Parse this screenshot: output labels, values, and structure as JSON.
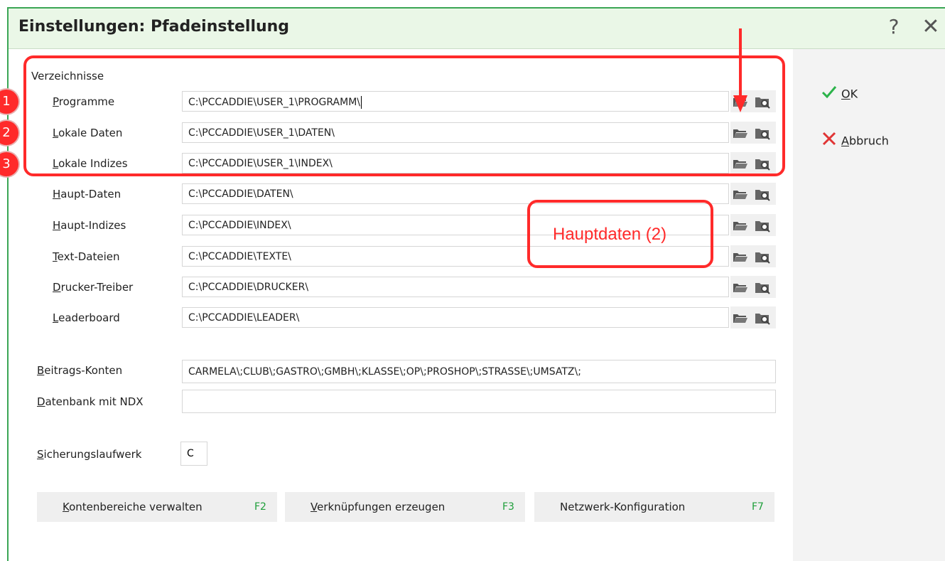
{
  "window": {
    "title": "Einstellungen: Pfadeinstellung",
    "help_glyph": "?",
    "close_glyph": "✕"
  },
  "side_buttons": {
    "ok": {
      "icon": "check-icon",
      "label_underlined": "O",
      "label_rest": "K"
    },
    "cancel": {
      "icon": "x-icon",
      "label_underlined": "A",
      "label_rest": "bbruch"
    }
  },
  "group_label": "Verzeichnisse",
  "paths": [
    {
      "label_underlined": "P",
      "label_rest": "rogramme",
      "value": "C:\\PCCADDIE\\USER_1\\PROGRAMM\\"
    },
    {
      "label_underlined": "L",
      "label_rest": "okale Daten",
      "value": "C:\\PCCADDIE\\USER_1\\DATEN\\"
    },
    {
      "label_underlined": "L",
      "label_rest": "okale Indizes",
      "value": "C:\\PCCADDIE\\USER_1\\INDEX\\"
    },
    {
      "label_underlined": "H",
      "label_rest": "aupt-Daten",
      "value": "C:\\PCCADDIE\\DATEN\\"
    },
    {
      "label_underlined": "H",
      "label_rest": "aupt-Indizes",
      "value": "C:\\PCCADDIE\\INDEX\\"
    },
    {
      "label_underlined": "T",
      "label_rest": "ext-Dateien",
      "value": "C:\\PCCADDIE\\TEXTE\\"
    },
    {
      "label_underlined": "D",
      "label_rest": "rucker-Treiber",
      "value": "C:\\PCCADDIE\\DRUCKER\\"
    },
    {
      "label_underlined": "L",
      "label_rest": "eaderboard",
      "value": "C:\\PCCADDIE\\LEADER\\"
    }
  ],
  "beitrags": {
    "label_underlined": "B",
    "label_rest": "eitrags-Konten",
    "value": "CARMELA\\;CLUB\\;GASTRO\\;GMBH\\;KLASSE\\;OP\\;PROSHOP\\;STRASSE\\;UMSATZ\\;"
  },
  "datenbank": {
    "label_underlined": "D",
    "label_rest": "atenbank mit NDX",
    "value": ""
  },
  "sicherung": {
    "label_underlined": "S",
    "label_rest": "icherungslaufwerk",
    "value": "C"
  },
  "bottom_buttons": [
    {
      "label_underlined": "K",
      "label_rest": "ontenbereiche verwalten",
      "key": "F2"
    },
    {
      "label_underlined": "V",
      "label_rest": "erknüpfungen erzeugen",
      "key": "F3"
    },
    {
      "label_underlined": "",
      "label_rest": "Netzwerk-Konfiguration",
      "key": "F7"
    }
  ],
  "annotations": {
    "badges": [
      "1",
      "2",
      "3"
    ],
    "callout": "Hauptdaten (2)",
    "color": "#ff2a2a"
  },
  "colors": {
    "accent_green": "#1e9e3a",
    "title_bg": "#eaf7e7",
    "annotation_red": "#ff2a2a"
  }
}
